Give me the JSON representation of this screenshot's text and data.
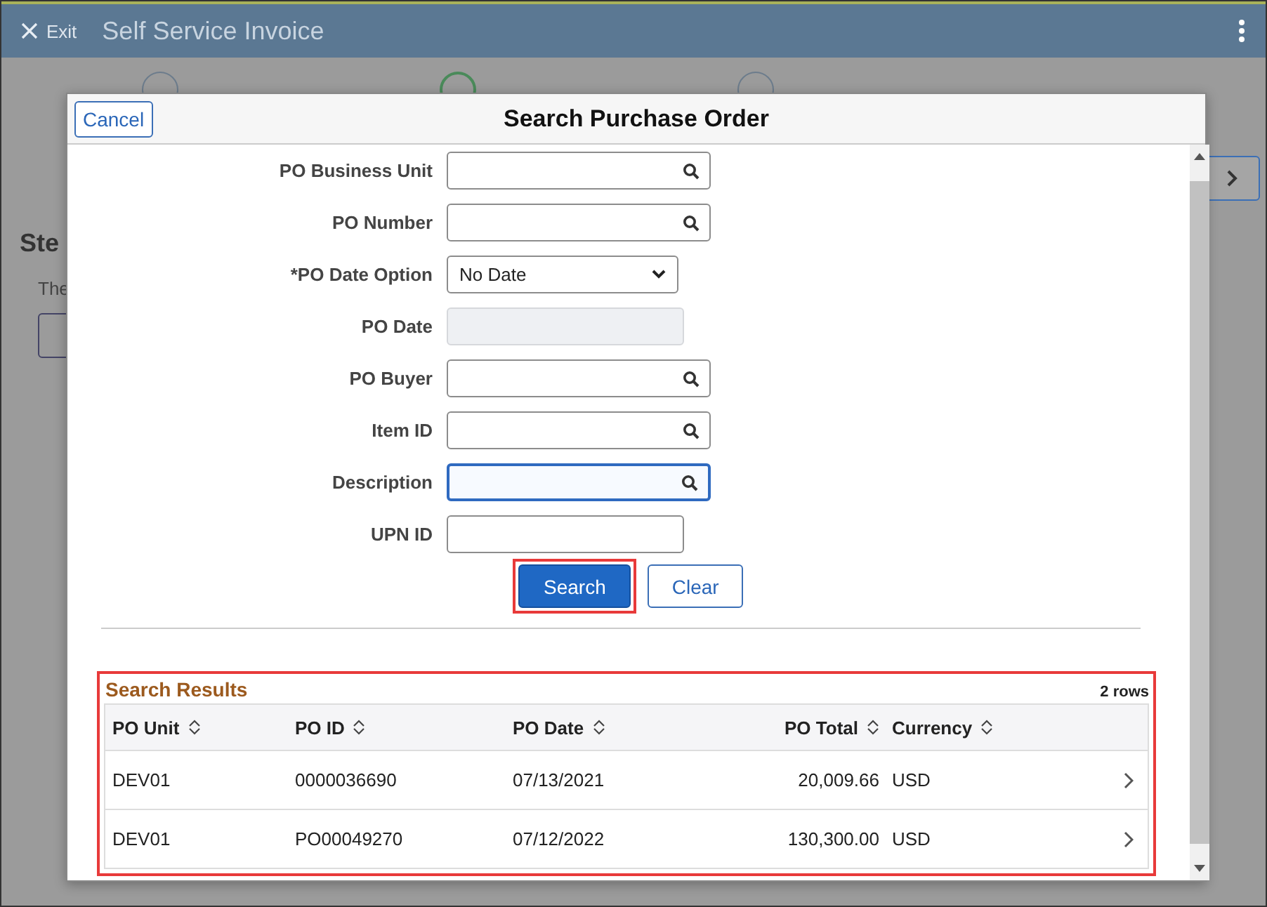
{
  "header": {
    "exit_label": "Exit",
    "title": "Self Service Invoice"
  },
  "background": {
    "steps": [
      {
        "selected": false
      },
      {
        "selected": true
      },
      {
        "selected": false
      }
    ],
    "heading": "Ste",
    "text": "The"
  },
  "modal": {
    "cancel": "Cancel",
    "title": "Search Purchase Order",
    "fields": [
      {
        "label": "PO Business Unit",
        "kind": "lookup",
        "focused": false
      },
      {
        "label": "PO Number",
        "kind": "lookup",
        "focused": false
      },
      {
        "label": "*PO Date Option",
        "kind": "select",
        "value": "No Date",
        "focused": false
      },
      {
        "label": "PO Date",
        "kind": "disabled"
      },
      {
        "label": "PO Buyer",
        "kind": "lookup",
        "focused": false
      },
      {
        "label": "Item ID",
        "kind": "lookup",
        "focused": false
      },
      {
        "label": "Description",
        "kind": "lookup",
        "focused": true
      },
      {
        "label": "UPN ID",
        "kind": "text",
        "focused": false
      }
    ],
    "search_button": {
      "label": "Search",
      "highlighted": true
    },
    "clear_button": {
      "label": "Clear"
    },
    "results": {
      "title": "Search Results",
      "count": "2 rows",
      "highlighted": true,
      "columns": [
        {
          "label": "PO Unit"
        },
        {
          "label": "PO ID"
        },
        {
          "label": "PO Date"
        },
        {
          "label": "PO Total"
        },
        {
          "label": "Currency"
        }
      ],
      "rows": [
        [
          "DEV01",
          "0000036690",
          "07/13/2021",
          "20,009.66",
          "USD"
        ],
        [
          "DEV01",
          "PO00049270",
          "07/12/2022",
          "130,300.00",
          "USD"
        ]
      ]
    }
  }
}
